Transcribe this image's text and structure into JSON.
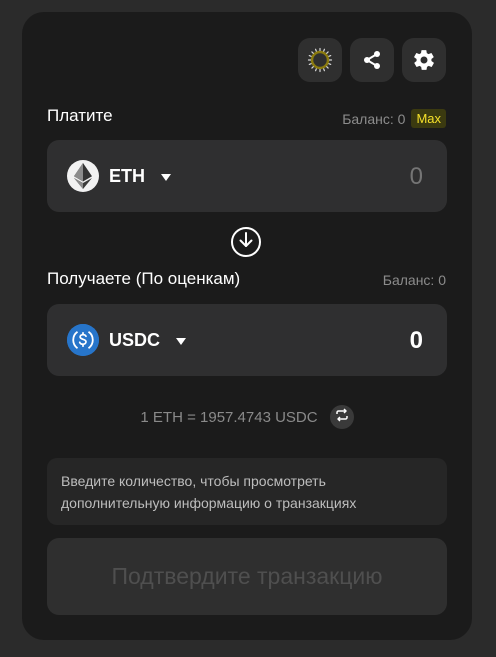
{
  "header": {
    "buttons": [
      {
        "icon": "spinner-icon"
      },
      {
        "icon": "share-icon"
      },
      {
        "icon": "gear-icon"
      }
    ]
  },
  "pay": {
    "label": "Платите",
    "balance_text": "Баланс: 0",
    "max_label": "Max",
    "token_symbol": "ETH",
    "token_icon": "ethereum-icon",
    "amount_placeholder": "0"
  },
  "receive": {
    "label": "Получаете (По оценкам)",
    "balance_text": "Баланс: 0",
    "token_symbol": "USDC",
    "token_icon": "usdc-icon",
    "amount": "0"
  },
  "rate": {
    "text": "1 ETH = 1957.4743 USDC"
  },
  "info": {
    "text": "Введите количество, чтобы просмотреть дополнительную информацию о транзакциях"
  },
  "confirm": {
    "label": "Подтвердите транзакцию"
  },
  "colors": {
    "background": "#2b2b2b",
    "card": "#1b1b1b",
    "field": "#2f2f30",
    "max_accent": "#f5e02a",
    "usdc_blue": "#2775ca"
  }
}
